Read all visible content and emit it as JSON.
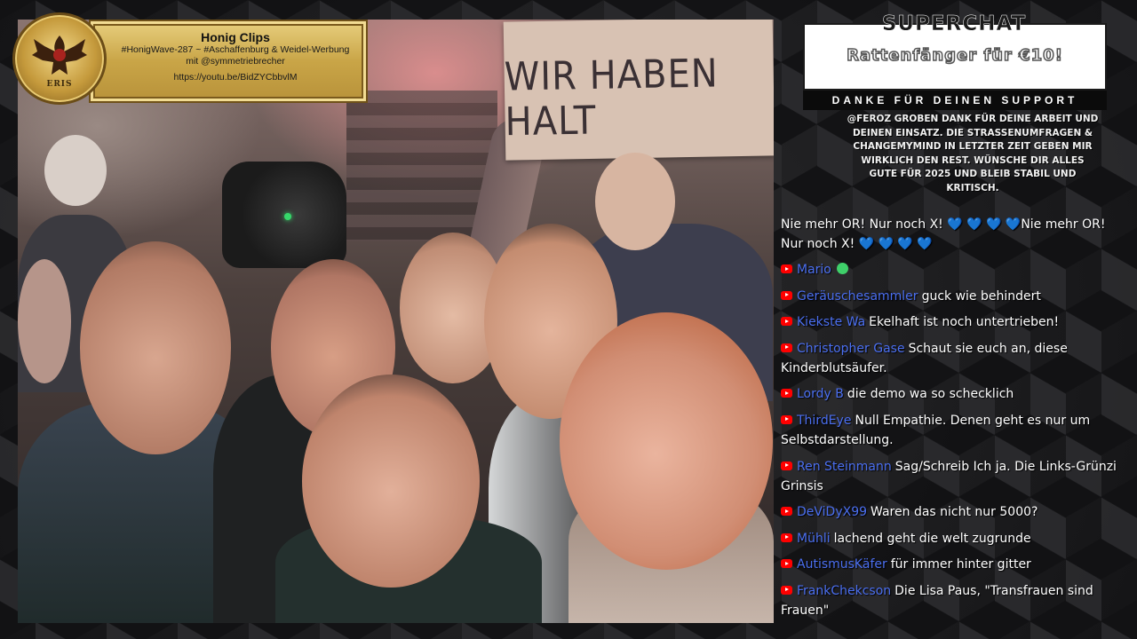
{
  "clip_banner": {
    "title": "Honig Clips",
    "line1": "#HonigWave-287 ~ #Aschaffenburg & Weidel-Werbung",
    "line2": "mit @symmetriebrecher",
    "url": "https://youtu.be/BidZYCbbvlM",
    "logo_text": "ERIS"
  },
  "video": {
    "sign_text": "WIR HABEN HALT"
  },
  "superchat": {
    "header": "SUPERCHAT",
    "amount_line": "Rattenfänger für €10!",
    "thanks": "DANKE FÜR DEINEN SUPPORT",
    "message": "@FEROZ GROBEN DANK FÜR DEINE ARBEIT UND DEINEN EINSATZ. DIE STRAßENUMFRAGEN & CHANGEMYMIND IN LETZTER ZEIT GEBEN MIR WIRKLICH DEN REST. WÜNSCHE DIR ALLES GUTE FÜR 2025 UND BLEIB STABIL UND KRITISCH."
  },
  "chat": {
    "first_message": {
      "part1": "Nie mehr OR! Nur noch X!",
      "hearts1": "💙 💙 💙 💙",
      "part2": "Nie mehr OR! Nur noch X!",
      "hearts2": "💙 💙 💙 💙"
    },
    "messages": [
      {
        "user": "Mario",
        "text": ""
      },
      {
        "user": "Geräuschesammler",
        "text": "guck wie behindert"
      },
      {
        "user": "Kiekste Wa",
        "text": "Ekelhaft ist noch untertrieben!"
      },
      {
        "user": "Christopher Gase",
        "text": "Schaut sie euch an, diese Kinderblutsäufer."
      },
      {
        "user": "Lordy B",
        "text": "die demo wa so schecklich"
      },
      {
        "user": "ThirdEye",
        "text": "Null Empathie. Denen geht es nur um Selbstdarstellung."
      },
      {
        "user": "Ren Steinmann",
        "text": "Sag/Schreib Ich ja. Die Links-Grünzi Grinsis"
      },
      {
        "user": "DeViDyX99",
        "text": "Waren das nicht nur 5000?"
      },
      {
        "user": "Mühli",
        "text": "lachend geht die welt zugrunde"
      },
      {
        "user": "AutismusKäfer",
        "text": "für immer hinter gitter"
      },
      {
        "user": "FrankChekcson",
        "text": "Die Lisa Paus, \"Transfrauen sind Frauen\""
      }
    ]
  },
  "colors": {
    "username": "#4b6ff0",
    "yt_badge": "#ff0000",
    "gold": "#c9a547"
  }
}
